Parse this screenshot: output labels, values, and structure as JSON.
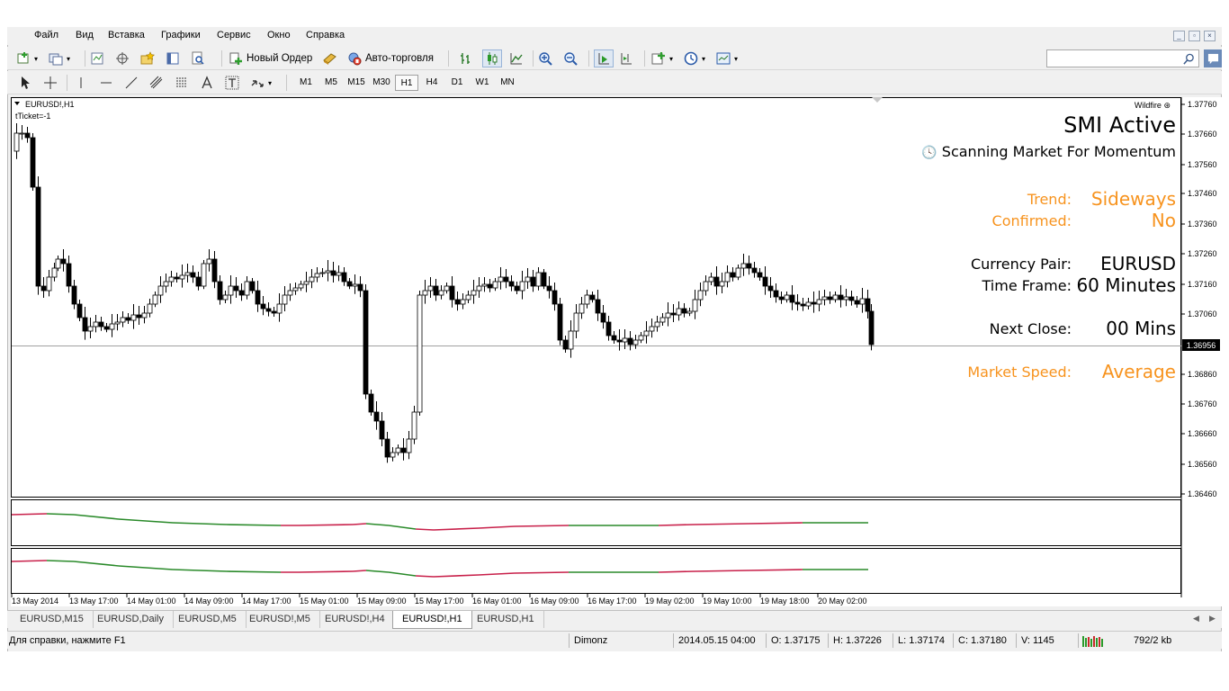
{
  "menu": [
    "Файл",
    "Вид",
    "Вставка",
    "Графики",
    "Сервис",
    "Окно",
    "Справка"
  ],
  "toolbar": {
    "new_order": "Новый Ордер",
    "auto_trading": "Авто-торговля"
  },
  "timeframes": [
    "M1",
    "M5",
    "M15",
    "M30",
    "H1",
    "H4",
    "D1",
    "W1",
    "MN"
  ],
  "active_timeframe": "H1",
  "chart": {
    "symbol_label": "EURUSD!,H1",
    "ticket_label": "tTicket=-1",
    "current_price": "1.36956",
    "price_labels": [
      "1.37760",
      "1.37660",
      "1.37560",
      "1.37460",
      "1.37360",
      "1.37260",
      "1.37160",
      "1.37060",
      "1.36956",
      "1.36860",
      "1.36760",
      "1.36660",
      "1.36560",
      "1.36460"
    ],
    "time_labels": [
      "13 May 2014",
      "13 May 17:00",
      "14 May 01:00",
      "14 May 09:00",
      "14 May 17:00",
      "15 May 01:00",
      "15 May 09:00",
      "15 May 17:00",
      "16 May 01:00",
      "16 May 09:00",
      "16 May 17:00",
      "19 May 02:00",
      "19 May 10:00",
      "19 May 18:00",
      "20 May 02:00"
    ]
  },
  "panel": {
    "brand": "Wildfire",
    "title": "SMI Active",
    "subtitle": "Scanning Market For Momentum",
    "trend_label": "Trend:",
    "trend_value": "Sideways",
    "confirmed_label": "Confirmed:",
    "confirmed_value": "No",
    "pair_label": "Currency Pair:",
    "pair_value": "EURUSD",
    "tf_label": "Time Frame:",
    "tf_value": "60 Minutes",
    "close_label": "Next Close:",
    "close_value": "00 Mins",
    "speed_label": "Market Speed:",
    "speed_value": "Average",
    "accent_color": "#f7931e"
  },
  "tabs": [
    "EURUSD,M15",
    "EURUSD,Daily",
    "EURUSD,M5",
    "EURUSD!,M5",
    "EURUSD!,H4",
    "EURUSD!,H1",
    "EURUSD,H1"
  ],
  "active_tab": "EURUSD!,H1",
  "status": {
    "help": "Для справки, нажмите F1",
    "profile": "Dimonz",
    "datetime": "2014.05.15 04:00",
    "open": "O: 1.37175",
    "high": "H: 1.37226",
    "low": "L: 1.37174",
    "close": "C: 1.37180",
    "volume": "V: 1145",
    "traffic": "792/2 kb"
  }
}
